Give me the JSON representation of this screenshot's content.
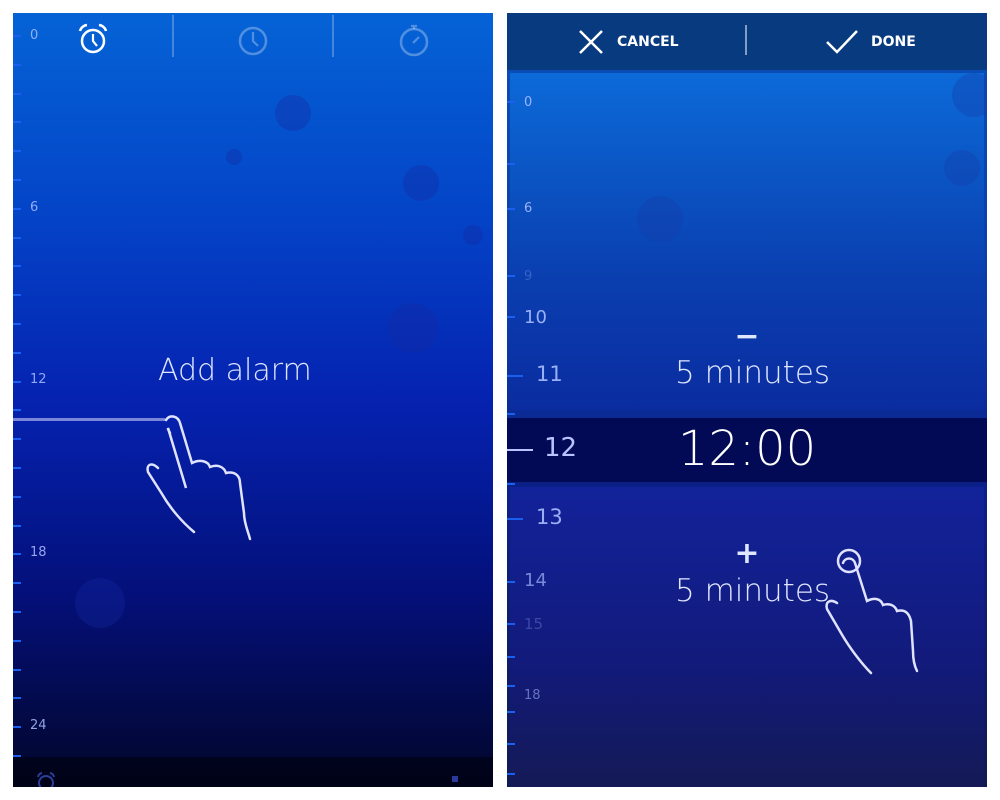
{
  "left_screen": {
    "tabs": [
      {
        "name": "alarm",
        "icon": "alarm-clock-icon",
        "active": true
      },
      {
        "name": "clock",
        "icon": "clock-icon",
        "active": false
      },
      {
        "name": "stopwatch",
        "icon": "stopwatch-icon",
        "active": false
      }
    ],
    "hour_labels": [
      "0",
      "6",
      "12",
      "18",
      "24"
    ],
    "hint_text": "Add alarm",
    "bottom_icons": [
      "alarm-clock-icon",
      "square-icon"
    ]
  },
  "right_screen": {
    "header": {
      "cancel_label": "CANCEL",
      "done_label": "DONE",
      "cancel_icon": "close-icon",
      "done_icon": "check-icon"
    },
    "hour_labels": [
      "0",
      "6",
      "9",
      "10",
      "11",
      "12",
      "13",
      "14",
      "15",
      "18"
    ],
    "minus_label": "−",
    "minus_text": "5 minutes",
    "selected_time": "12:00",
    "plus_label": "+",
    "plus_text": "5 minutes"
  },
  "colors": {
    "accent": "#1a5ff0",
    "header": "#083a80",
    "band": "#030a55"
  }
}
